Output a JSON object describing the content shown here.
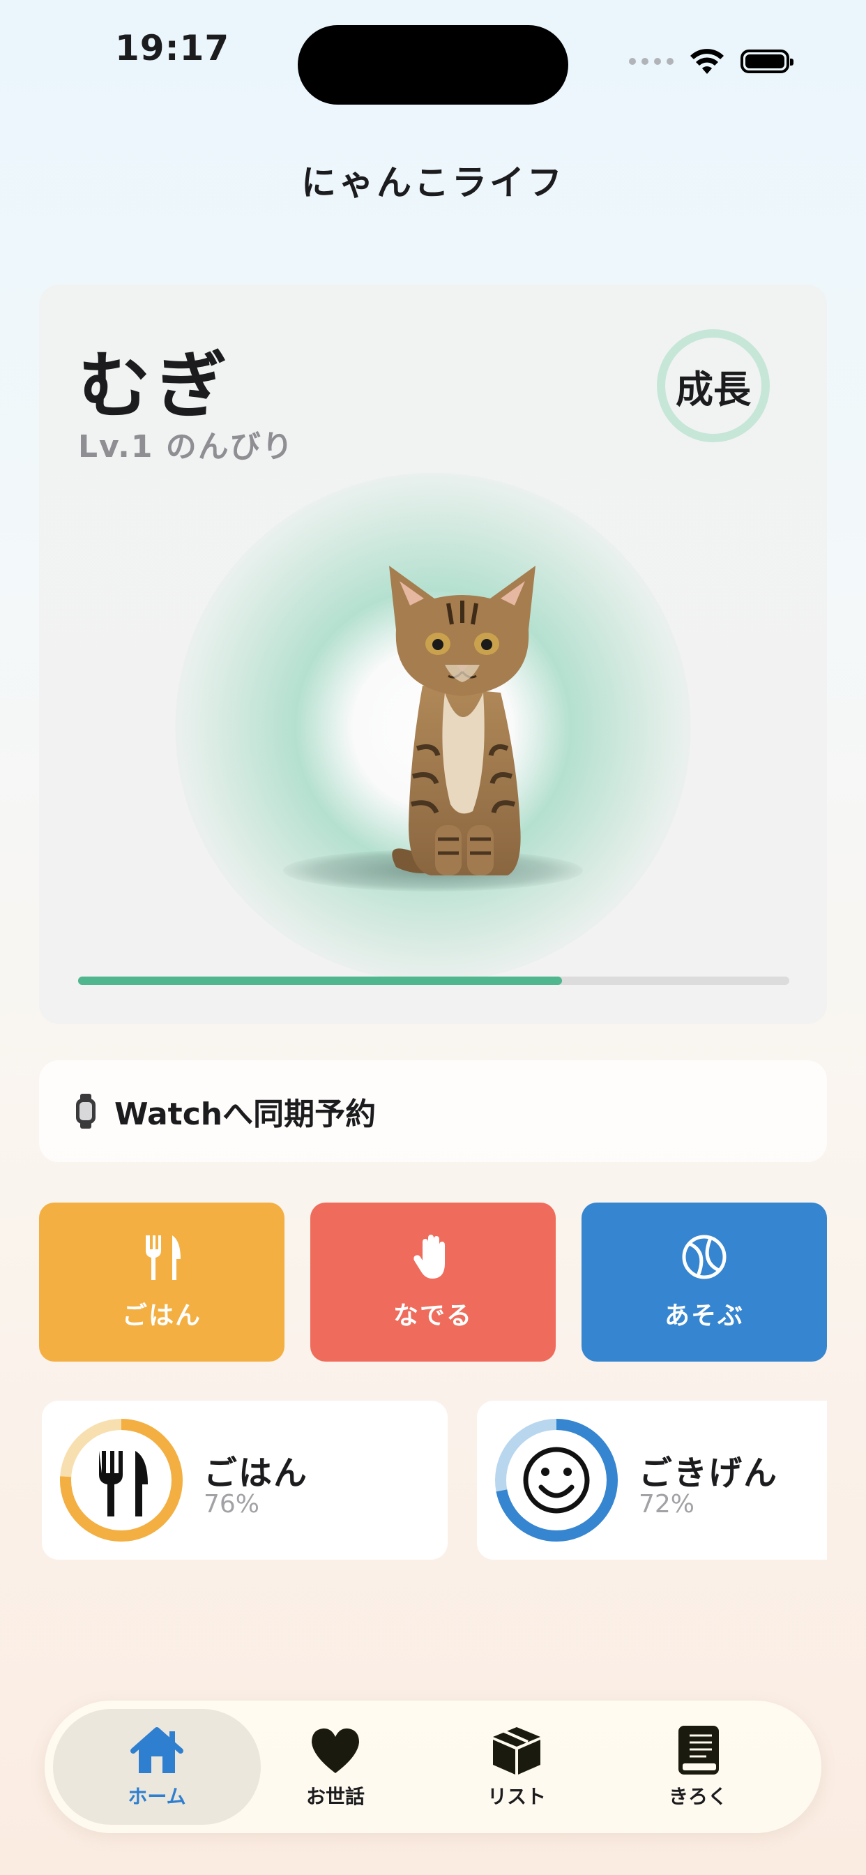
{
  "status_bar": {
    "time": "19:17"
  },
  "header": {
    "title": "にゃんこライフ"
  },
  "pet": {
    "name": "むぎ",
    "level_text": "Lv.1 のんびり",
    "stage_badge": "成長",
    "growth_progress": 0.68
  },
  "watch": {
    "label": "Watchへ同期予約"
  },
  "actions": [
    {
      "label": "ごはん",
      "icon": "fork-knife-icon",
      "color": "#f3af41"
    },
    {
      "label": "なでる",
      "icon": "hand-icon",
      "color": "#ef6b5b"
    },
    {
      "label": "あそぶ",
      "icon": "ball-icon",
      "color": "#3585d0"
    }
  ],
  "stats": [
    {
      "label": "ごはん",
      "value_text": "76%",
      "value": 0.76,
      "icon": "fork-knife-icon",
      "color": "#f3af41",
      "track": "#f8dfb0"
    },
    {
      "label": "ごきげん",
      "value_text": "72%",
      "value": 0.72,
      "icon": "smiley-icon",
      "color": "#3585d0",
      "track": "#b9d6ef"
    }
  ],
  "tabs": [
    {
      "label": "ホーム",
      "icon": "home-icon",
      "active": true
    },
    {
      "label": "お世話",
      "icon": "heart-icon",
      "active": false
    },
    {
      "label": "リスト",
      "icon": "box-icon",
      "active": false
    },
    {
      "label": "きろく",
      "icon": "book-icon",
      "active": false
    }
  ],
  "colors": {
    "accent_green": "#4fb68d",
    "tab_active": "#2f7fd0"
  }
}
